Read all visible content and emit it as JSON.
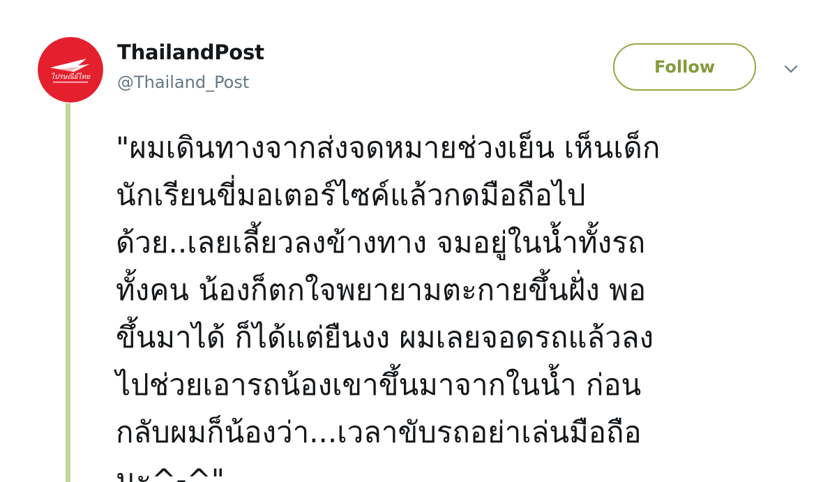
{
  "user": {
    "display_name": "ThailandPost",
    "handle": "@Thailand_Post",
    "avatar": {
      "icon": "thailand-post-logo-icon",
      "logo_text": "ไปรษณีย์ไทย",
      "background_color": "#e5202e"
    }
  },
  "actions": {
    "follow_label": "Follow",
    "menu_icon": "chevron-down-icon"
  },
  "tweet": {
    "lines": [
      "\"ผมเดินทางจากส่งจดหมายช่วงเย็น เห็นเด็ก",
      "นักเรียนขี่มอเตอร์ไซค์แล้วกดมือถือไป",
      "ด้วย..เลยเลี้ยวลงข้างทาง จมอยู่ในน้ำทั้งรถ",
      "ทั้งคน น้องก็ตกใจพยายามตะกายขึ้นฝั่ง พอ",
      "ขึ้นมาได้ ก็ได้แต่ยืนงง ผมเลยจอดรถแล้วลง",
      "ไปช่วยเอารถน้องเขาขึ้นมาจากในน้ำ ก่อน",
      "กลับผมก็น้องว่า...เวลาขับรถอย่าเล่นมือถือ",
      "นะ^-^\""
    ]
  },
  "colors": {
    "accent": "#86993a",
    "thread_line": "#c5d49a",
    "handle": "#657786",
    "text": "#14171a"
  }
}
